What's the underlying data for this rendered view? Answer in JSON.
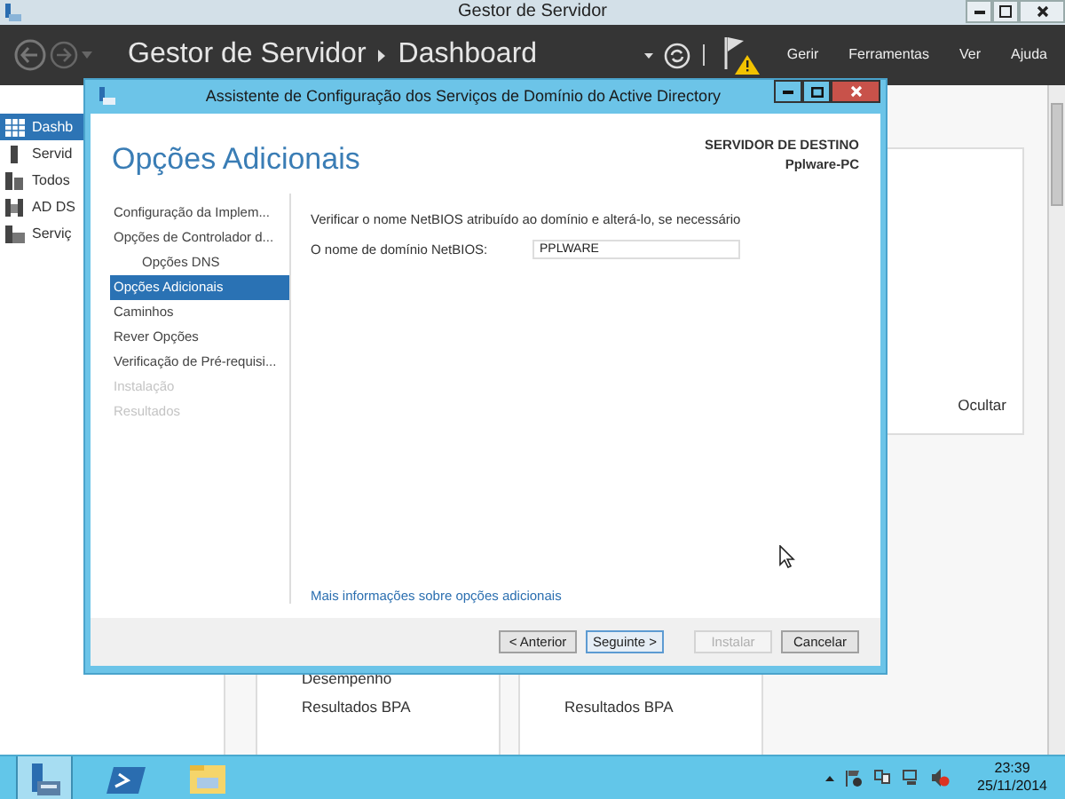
{
  "window": {
    "title": "Gestor de Servidor"
  },
  "header": {
    "breadcrumb": [
      "Gestor de Servidor",
      "Dashboard"
    ],
    "menu": [
      "Gerir",
      "Ferramentas",
      "Ver",
      "Ajuda"
    ]
  },
  "sidebar": {
    "items": [
      {
        "label": "Dashb",
        "kind": "dashboard",
        "selected": true
      },
      {
        "label": "Servid",
        "kind": "server",
        "selected": false
      },
      {
        "label": "Todos",
        "kind": "servers",
        "selected": false
      },
      {
        "label": "AD DS",
        "kind": "role",
        "selected": false
      },
      {
        "label": "Serviç",
        "kind": "files",
        "selected": false
      }
    ]
  },
  "hide_link": "Ocultar",
  "tiles": [
    {
      "links": [
        "Desempenho",
        "Resultados BPA"
      ]
    },
    {
      "links": [
        "Resultados BPA"
      ]
    }
  ],
  "dialog": {
    "title": "Assistente de Configuração dos Serviços de Domínio do Active Directory",
    "heading": "Opções Adicionais",
    "target_label": "SERVIDOR DE DESTINO",
    "target_name": "Pplware-PC",
    "steps": [
      {
        "label": "Configuração da Implem...",
        "selected": false,
        "disabled": false
      },
      {
        "label": "Opções de Controlador d...",
        "selected": false,
        "disabled": false,
        "children": [
          {
            "label": "Opções DNS",
            "selected": false,
            "disabled": false
          }
        ]
      },
      {
        "label": "Opções Adicionais",
        "selected": true,
        "disabled": false
      },
      {
        "label": "Caminhos",
        "selected": false,
        "disabled": false
      },
      {
        "label": "Rever Opções",
        "selected": false,
        "disabled": false
      },
      {
        "label": "Verificação de Pré-requisi...",
        "selected": false,
        "disabled": false
      },
      {
        "label": "Instalação",
        "selected": false,
        "disabled": true
      },
      {
        "label": "Resultados",
        "selected": false,
        "disabled": true
      }
    ],
    "description": "Verificar o nome NetBIOS atribuído ao domínio e alterá-lo, se necessário",
    "field": {
      "label": "O nome de domínio NetBIOS:",
      "value": "PPLWARE"
    },
    "more_link": "Mais informações sobre opções adicionais",
    "buttons": [
      {
        "label": "< Anterior",
        "default": false,
        "disabled": false
      },
      {
        "label": "Seguinte >",
        "default": true,
        "disabled": false
      },
      {
        "label": "Instalar",
        "default": false,
        "disabled": true
      },
      {
        "label": "Cancelar",
        "default": false,
        "disabled": false
      }
    ]
  },
  "taskbar": {
    "apps": [
      {
        "kind": "server-manager",
        "selected": true
      },
      {
        "kind": "powershell",
        "selected": false
      },
      {
        "kind": "explorer",
        "selected": false
      }
    ]
  },
  "clock": {
    "time": "23:39",
    "date": "25/11/2014"
  }
}
